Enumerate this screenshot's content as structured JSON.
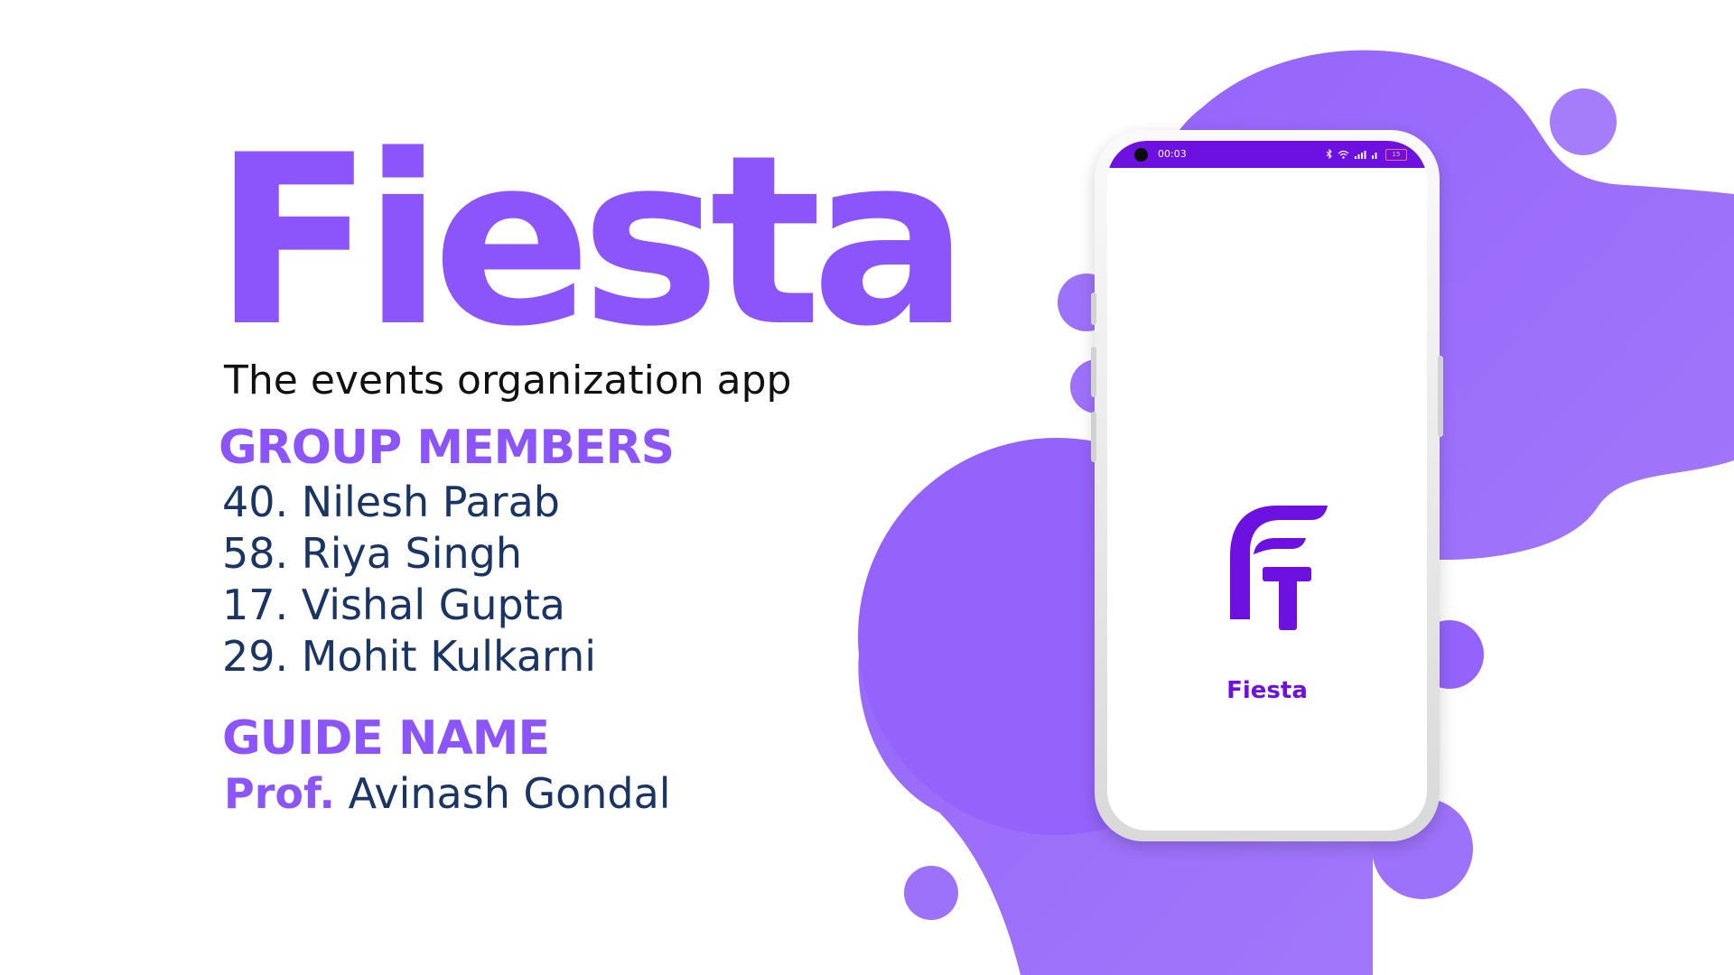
{
  "colors": {
    "accent": "#8b55fb",
    "deep_purple": "#6d11e0",
    "text_navy": "#1a3564",
    "blob": "#9d72fa"
  },
  "poster": {
    "title": "Fiesta",
    "subtitle": "The events organization app",
    "members_heading": "GROUP MEMBERS",
    "members": [
      "40. Nilesh Parab",
      "58. Riya Singh",
      "17. Vishal Gupta",
      "29. Mohit Kulkarni"
    ],
    "guide_heading": "GUIDE NAME",
    "guide_prefix": "Prof.",
    "guide_name": "Avinash Gondal"
  },
  "phone": {
    "status_time": "00:03",
    "battery": "15",
    "status_icons": [
      "bluetooth-icon",
      "wifi-icon",
      "signal-icon",
      "battery-icon"
    ],
    "app_logo": "fiesta-logo-icon",
    "app_name": "Fiesta"
  }
}
